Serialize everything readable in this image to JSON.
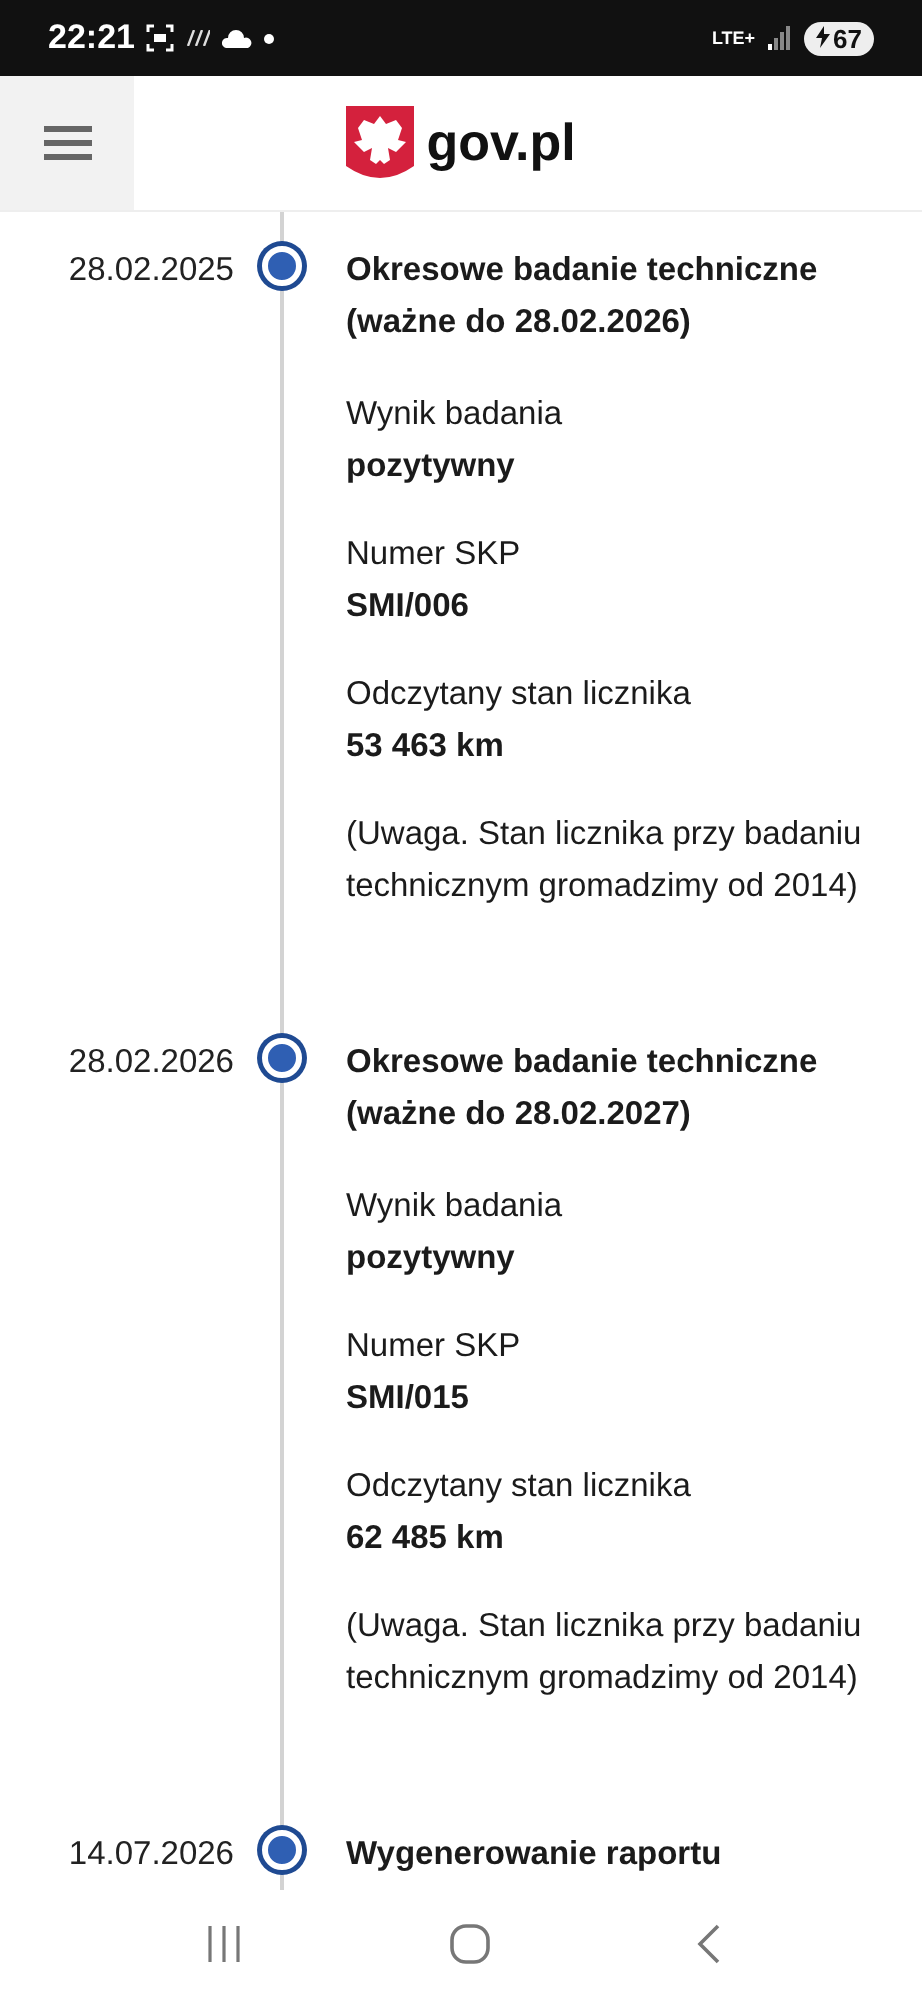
{
  "status_bar": {
    "time": "22:21",
    "network": "LTE+",
    "battery": "67"
  },
  "header": {
    "logo_text": "gov.pl"
  },
  "timeline": [
    {
      "date": "28.02.2025",
      "title": "Okresowe badanie techniczne (ważne do 28.02.2026)",
      "fields": [
        {
          "label": "Wynik badania",
          "value": "pozytywny"
        },
        {
          "label": "Numer SKP",
          "value": "SMI/006"
        },
        {
          "label": "Odczytany stan licznika",
          "value": "53 463 km"
        }
      ],
      "note": "(Uwaga. Stan licznika przy badaniu technicznym gromadzimy od 2014)"
    },
    {
      "date": "28.02.2026",
      "title": "Okresowe badanie techniczne (ważne do 28.02.2027)",
      "fields": [
        {
          "label": "Wynik badania",
          "value": "pozytywny"
        },
        {
          "label": "Numer SKP",
          "value": "SMI/015"
        },
        {
          "label": "Odczytany stan licznika",
          "value": "62 485 km"
        }
      ],
      "note": "(Uwaga. Stan licznika przy badaniu technicznym gromadzimy od 2014)"
    },
    {
      "date": "14.07.2026",
      "title": "Wygenerowanie raportu"
    }
  ]
}
